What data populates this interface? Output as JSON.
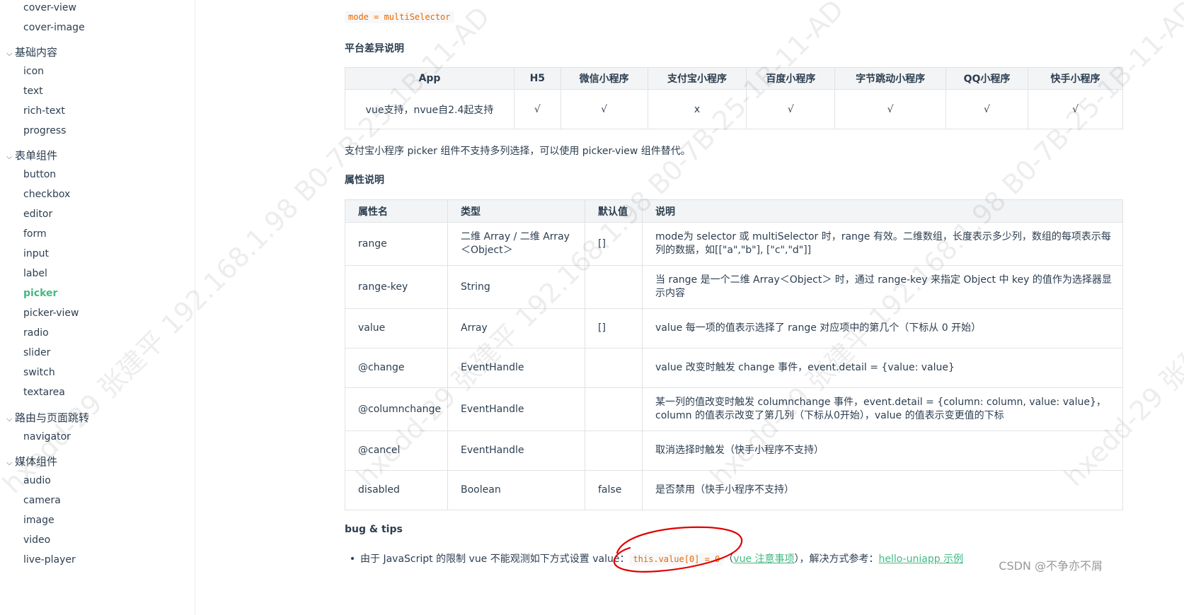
{
  "sidebar": {
    "items": [
      {
        "type": "item",
        "label": "cover-view"
      },
      {
        "type": "item",
        "label": "cover-image"
      },
      {
        "type": "group",
        "label": "基础内容"
      },
      {
        "type": "item",
        "label": "icon"
      },
      {
        "type": "item",
        "label": "text"
      },
      {
        "type": "item",
        "label": "rich-text"
      },
      {
        "type": "item",
        "label": "progress"
      },
      {
        "type": "group",
        "label": "表单组件"
      },
      {
        "type": "item",
        "label": "button"
      },
      {
        "type": "item",
        "label": "checkbox"
      },
      {
        "type": "item",
        "label": "editor"
      },
      {
        "type": "item",
        "label": "form"
      },
      {
        "type": "item",
        "label": "input"
      },
      {
        "type": "item",
        "label": "label"
      },
      {
        "type": "item",
        "label": "picker",
        "active": true
      },
      {
        "type": "item",
        "label": "picker-view"
      },
      {
        "type": "item",
        "label": "radio"
      },
      {
        "type": "item",
        "label": "slider"
      },
      {
        "type": "item",
        "label": "switch"
      },
      {
        "type": "item",
        "label": "textarea"
      },
      {
        "type": "group",
        "label": "路由与页面跳转"
      },
      {
        "type": "item",
        "label": "navigator"
      },
      {
        "type": "group",
        "label": "媒体组件"
      },
      {
        "type": "item",
        "label": "audio"
      },
      {
        "type": "item",
        "label": "camera"
      },
      {
        "type": "item",
        "label": "image"
      },
      {
        "type": "item",
        "label": "video"
      },
      {
        "type": "item",
        "label": "live-player"
      }
    ]
  },
  "main": {
    "mode_code": "mode = multiSelector",
    "platform_heading": "平台差异说明",
    "platform_table": {
      "headers": [
        "App",
        "H5",
        "微信小程序",
        "支付宝小程序",
        "百度小程序",
        "字节跳动小程序",
        "QQ小程序",
        "快手小程序"
      ],
      "row": [
        "vue支持，nvue自2.4起支持",
        "√",
        "√",
        "x",
        "√",
        "√",
        "√",
        "√"
      ]
    },
    "alipay_note": "支付宝小程序 picker 组件不支持多列选择，可以使用 picker-view 组件替代。",
    "props_heading": "属性说明",
    "props_table": {
      "headers": [
        "属性名",
        "类型",
        "默认值",
        "说明"
      ],
      "rows": [
        [
          "range",
          "二维 Array / 二维 Array＜Object＞",
          "[]",
          "mode为 selector 或 multiSelector 时，range 有效。二维数组，长度表示多少列，数组的每项表示每列的数据，如[[\"a\",\"b\"], [\"c\",\"d\"]]"
        ],
        [
          "range-key",
          "String",
          "",
          "当 range 是一个二维 Array＜Object＞ 时，通过 range-key 来指定 Object 中 key 的值作为选择器显示内容"
        ],
        [
          "value",
          "Array",
          "[]",
          "value 每一项的值表示选择了 range 对应项中的第几个（下标从 0 开始）"
        ],
        [
          "@change",
          "EventHandle",
          "",
          "value 改变时触发 change 事件，event.detail = {value: value}"
        ],
        [
          "@columnchange",
          "EventHandle",
          "",
          "某一列的值改变时触发 columnchange 事件，event.detail = {column: column, value: value}，column 的值表示改变了第几列（下标从0开始），value 的值表示变更值的下标"
        ],
        [
          "@cancel",
          "EventHandle",
          "",
          "取消选择时触发（快手小程序不支持）"
        ],
        [
          "disabled",
          "Boolean",
          "false",
          "是否禁用（快手小程序不支持）"
        ]
      ]
    },
    "tips_heading": "bug & tips",
    "tips": {
      "bullet": "•",
      "prefix": "由于 JavaScript 的限制 vue 不能观测如下方式设置 value：",
      "code": "this.value[0] = 0",
      "paren_open": "（",
      "link1": "vue 注意事项",
      "paren_close": "），解决方式参考：",
      "link2": "hello-uniapp 示例"
    }
  },
  "watermark": {
    "text": "hxedd-29 张建平 192.168.1.98 B0-7B-25-1B-11-AD"
  },
  "csdn_badge": "CSDN @不争亦不屑",
  "colors": {
    "accent": "#42b983",
    "code": "#e96900",
    "annotation": "#e00000"
  }
}
